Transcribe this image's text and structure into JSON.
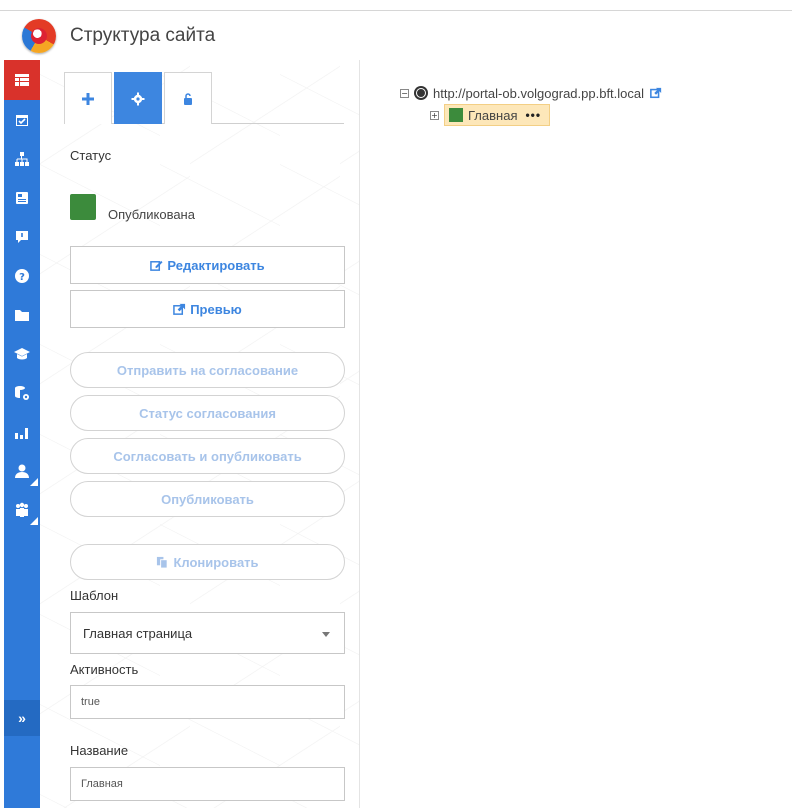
{
  "app": {
    "title": "Структура сайта"
  },
  "rail": {
    "items": [
      "table-icon",
      "calendar-check-icon",
      "sitemap-icon",
      "newspaper-icon",
      "comment-icon",
      "question-icon",
      "folder-icon",
      "graduation-cap-icon",
      "database-settings-icon",
      "bar-chart-icon",
      "user-icon",
      "users-icon"
    ],
    "expand_label": "»"
  },
  "tabs": [
    {
      "icon": "plus-icon",
      "active": false
    },
    {
      "icon": "gear-icon",
      "active": true
    },
    {
      "icon": "unlock-icon",
      "active": false
    }
  ],
  "status": {
    "label": "Статус",
    "value": "Опубликована",
    "color": "#3c8b3c"
  },
  "buttons": {
    "edit": "Редактировать",
    "preview": "Превью",
    "send_approval": "Отправить на согласование",
    "approval_status": "Статус согласования",
    "approve_publish": "Согласовать и опубликовать",
    "publish": "Опубликовать",
    "clone": "Клонировать"
  },
  "template": {
    "label": "Шаблон",
    "value": "Главная страница"
  },
  "activity": {
    "label": "Активность",
    "value": "true"
  },
  "name": {
    "label": "Название",
    "value": "Главная"
  },
  "tree": {
    "root_url": "http://portal-ob.volgograd.pp.bft.local",
    "child_label": "Главная",
    "child_more": "•••"
  },
  "colors": {
    "accent": "#3d86e0",
    "rail": "#2f7ad9",
    "rail_active": "#d9322b",
    "published": "#3c8b3c",
    "selected_node": "#fde7b9"
  }
}
